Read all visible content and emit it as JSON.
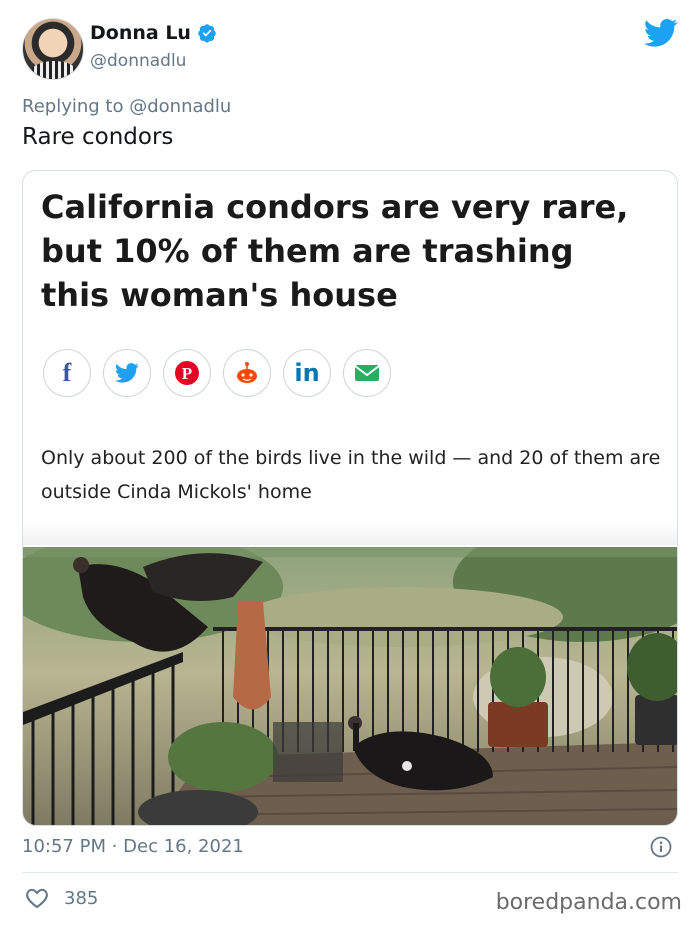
{
  "author": {
    "name": "Donna Lu",
    "handle": "@donnadlu",
    "verified": true
  },
  "reply": {
    "prefix": "Replying to",
    "mention": "@donnadlu"
  },
  "tweet_text": "Rare condors",
  "card": {
    "headline": "California condors are very rare, but 10% of them are trashing this woman's house",
    "share_buttons": [
      {
        "icon": "facebook-icon",
        "glyph": "f",
        "color": "#3b5998"
      },
      {
        "icon": "twitter-icon",
        "glyph": "",
        "color": "#1da1f2"
      },
      {
        "icon": "pinterest-icon",
        "glyph": "P",
        "color": "#e60023"
      },
      {
        "icon": "reddit-icon",
        "glyph": "",
        "color": "#ff4500"
      },
      {
        "icon": "linkedin-icon",
        "glyph": "in",
        "color": "#0077b5"
      },
      {
        "icon": "email-icon",
        "glyph": "",
        "color": "#27ae60"
      }
    ],
    "subhead": "Only about 200 of the birds live in the wild — and 20 of them are outside Cinda Mickols' home"
  },
  "timestamp": "10:57 PM · Dec 16, 2021",
  "likes": "385",
  "watermark": "boredpanda.com",
  "colors": {
    "twitter_blue": "#1da1f2",
    "muted": "#657786"
  }
}
